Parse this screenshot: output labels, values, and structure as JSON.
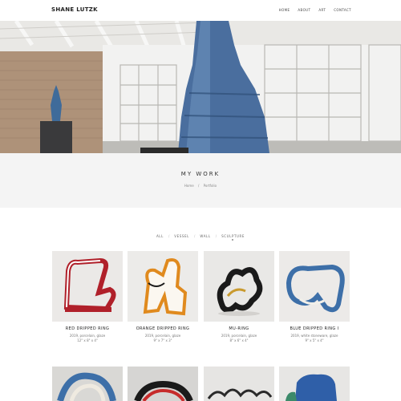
{
  "header": {
    "logo": "SHANE LUTZK",
    "nav": [
      "HOME",
      "ABOUT",
      "ART",
      "CONTACT"
    ]
  },
  "page": {
    "title": "MY WORK",
    "breadcrumb": [
      "Home",
      "/",
      "Portfolio"
    ]
  },
  "filters": [
    "ALL",
    "VESSEL",
    "WALL",
    "SCULPTURE"
  ],
  "works": [
    {
      "title": "RED DRIPPED RING",
      "meta1": "2019, porcelain, glaze",
      "meta2": "12\" x 8\" x 4\"",
      "color": "#b0202a"
    },
    {
      "title": "ORANGE DRIPPED RING",
      "meta1": "2019, porcelain, glaze",
      "meta2": "9\" x 7\" x 3\"",
      "color": "#e08a1e"
    },
    {
      "title": "MU-RING",
      "meta1": "2019, porcelain, glaze",
      "meta2": "8\" x 6\" x 4\"",
      "color": "#1a1a1a"
    },
    {
      "title": "BLUE DRIPPED RING I",
      "meta1": "2019, white stoneware, glaze",
      "meta2": "9\" x 5\" x 4\"",
      "color": "#3d6fa8"
    }
  ],
  "colors": {
    "accent": "#333333",
    "band": "#f4f4f4",
    "hero_vessel": "#4a6e9e"
  }
}
